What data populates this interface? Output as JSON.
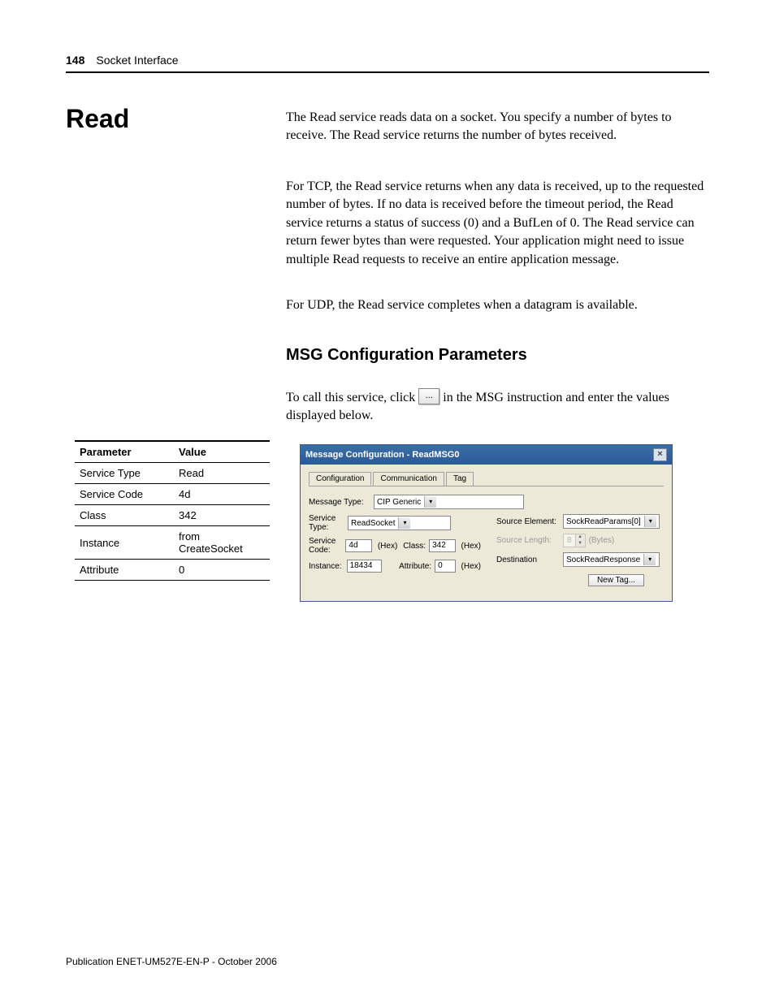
{
  "header": {
    "page_number": "148",
    "section": "Socket Interface"
  },
  "title": "Read",
  "paragraphs": {
    "p1": "The Read service reads data on a socket. You specify a number of bytes to receive. The Read service returns the number of bytes received.",
    "p2": "For TCP, the Read service returns when any data is received, up to the requested number of bytes. If no data is received before the timeout period, the Read service returns a status of success (0) and a BufLen of 0. The Read service can return fewer bytes than were requested. Your application might need to issue multiple Read requests to receive an entire application message.",
    "p3": "For UDP, the Read service completes when a datagram is available."
  },
  "subheading": "MSG Configuration Parameters",
  "instruction": {
    "before": "To call this service, click",
    "button": "...",
    "after": "in the MSG instruction and enter the values displayed below."
  },
  "param_table": {
    "headers": {
      "c1": "Parameter",
      "c2": "Value"
    },
    "rows": [
      {
        "p": "Service Type",
        "v": "Read"
      },
      {
        "p": "Service Code",
        "v": "4d"
      },
      {
        "p": "Class",
        "v": "342"
      },
      {
        "p": "Instance",
        "v": "from CreateSocket"
      },
      {
        "p": "Attribute",
        "v": "0"
      }
    ]
  },
  "dialog": {
    "title": "Message Configuration - ReadMSG0",
    "close": "×",
    "tabs": {
      "t1": "Configuration",
      "t2": "Communication",
      "t3": "Tag"
    },
    "message_type_label": "Message Type:",
    "message_type_value": "CIP Generic",
    "left": {
      "service_type_label": "Service Type:",
      "service_type_value": "ReadSocket",
      "service_code_label": "Service Code:",
      "service_code_value": "4d",
      "class_label": "Class:",
      "class_value": "342",
      "instance_label": "Instance:",
      "instance_value": "18434",
      "attribute_label": "Attribute:",
      "attribute_value": "0",
      "hex": "(Hex)"
    },
    "right": {
      "source_element_label": "Source Element:",
      "source_element_value": "SockReadParams[0]",
      "source_length_label": "Source Length:",
      "source_length_value": "8",
      "source_length_unit": "(Bytes)",
      "destination_label": "Destination",
      "destination_value": "SockReadResponse",
      "new_tag": "New Tag..."
    }
  },
  "footer": "Publication ENET-UM527E-EN-P - October 2006"
}
